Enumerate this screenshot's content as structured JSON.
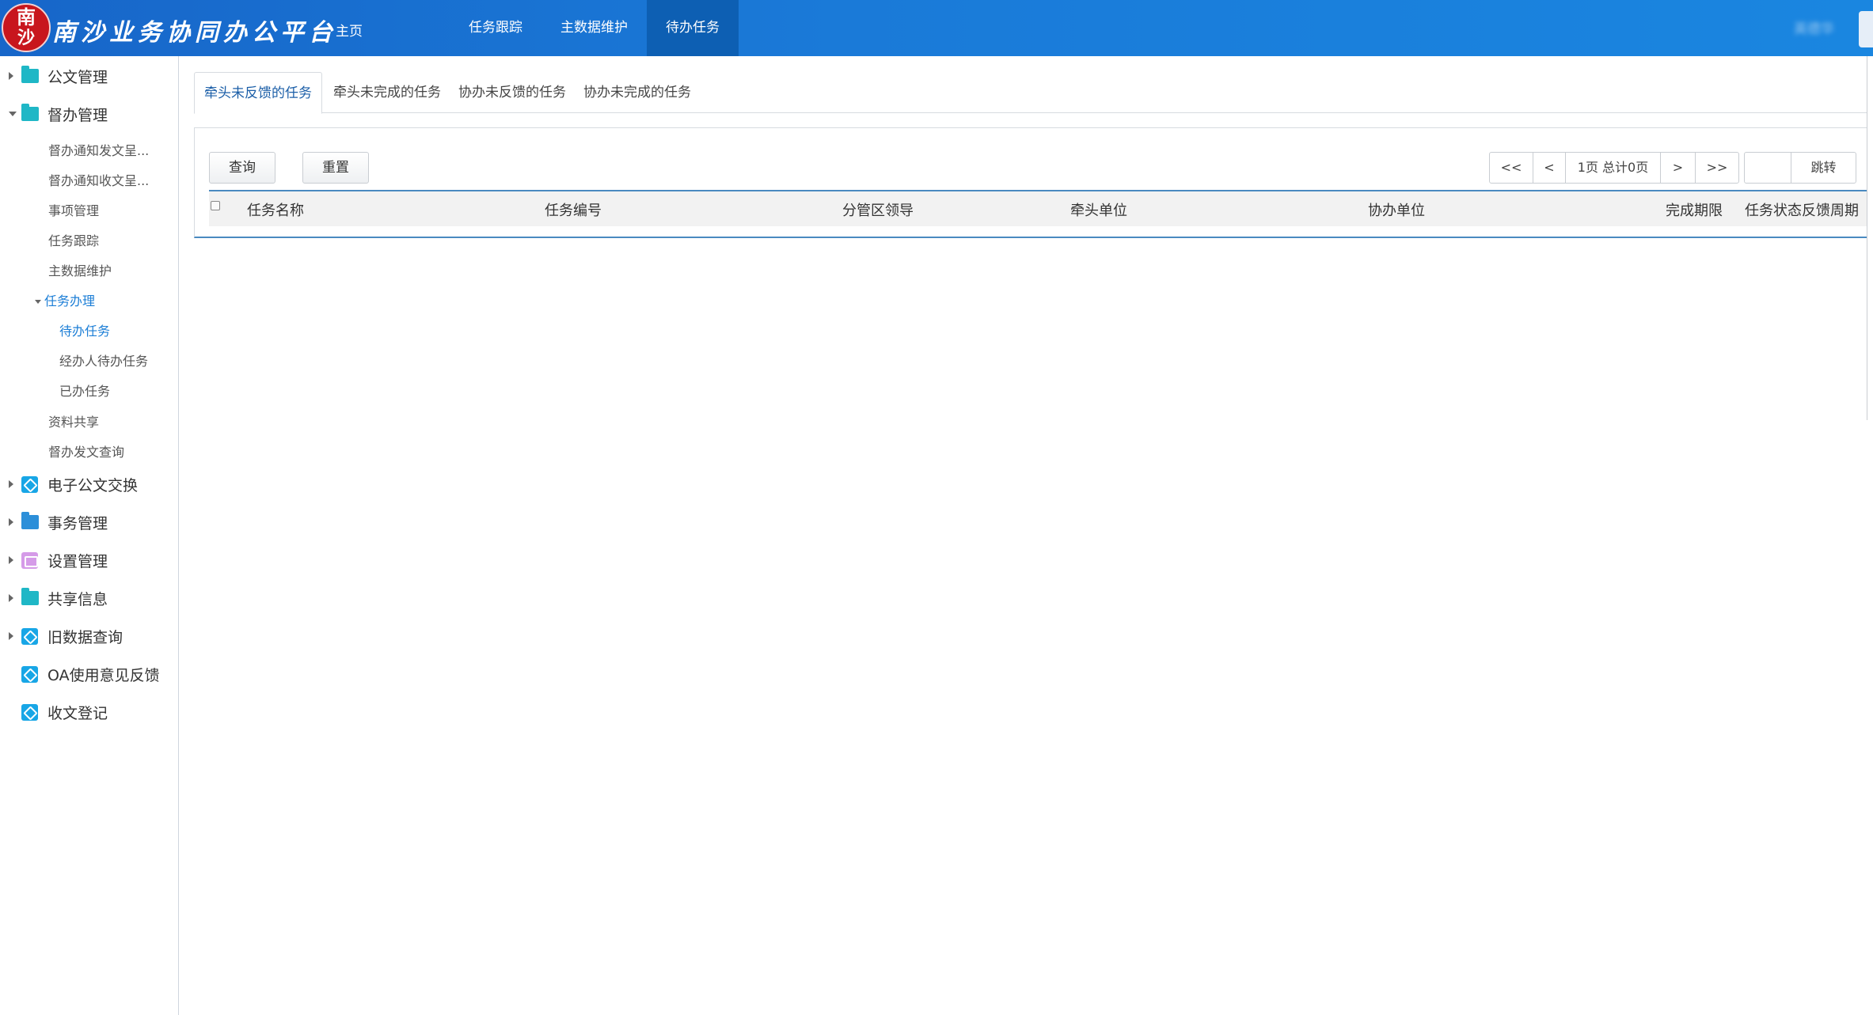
{
  "header": {
    "logo_line1": "南",
    "logo_line2": "沙",
    "app_title": "南沙业务协同办公平台",
    "home_label": "主页",
    "nav": [
      {
        "label": "任务跟踪"
      },
      {
        "label": "主数据维护"
      },
      {
        "label": "待办任务"
      }
    ],
    "user_name": "英德华"
  },
  "sidebar": {
    "groups": [
      {
        "label": "公文管理"
      },
      {
        "label": "督办管理"
      },
      {
        "label": "电子公文交换"
      },
      {
        "label": "事务管理"
      },
      {
        "label": "设置管理"
      },
      {
        "label": "共享信息"
      },
      {
        "label": "旧数据查询"
      },
      {
        "label": "OA使用意见反馈"
      },
      {
        "label": "收文登记"
      }
    ],
    "duban_items": [
      {
        "label": "督办通知发文呈..."
      },
      {
        "label": "督办通知收文呈..."
      },
      {
        "label": "事项管理"
      },
      {
        "label": "任务跟踪"
      },
      {
        "label": "主数据维护"
      },
      {
        "label": "任务办理"
      },
      {
        "label": "待办任务"
      },
      {
        "label": "经办人待办任务"
      },
      {
        "label": "已办任务"
      },
      {
        "label": "资料共享"
      },
      {
        "label": "督办发文查询"
      }
    ]
  },
  "tabs": [
    {
      "label": "牵头未反馈的任务"
    },
    {
      "label": "牵头未完成的任务"
    },
    {
      "label": "协办未反馈的任务"
    },
    {
      "label": "协办未完成的任务"
    }
  ],
  "toolbar": {
    "query_label": "查询",
    "reset_label": "重置",
    "pager_first": "<<",
    "pager_prev": "<",
    "pager_info": "1页 总计0页",
    "pager_next": ">",
    "pager_last": ">>",
    "jump_value": "",
    "jump_label": "跳转"
  },
  "table": {
    "columns": [
      {
        "label": "任务名称"
      },
      {
        "label": "任务编号"
      },
      {
        "label": "分管区领导"
      },
      {
        "label": "牵头单位"
      },
      {
        "label": "协办单位"
      },
      {
        "label": "完成期限"
      },
      {
        "label": "任务状态反馈周期"
      }
    ],
    "rows": []
  },
  "colors": {
    "header_bg": "#1a7ad8",
    "nav_active": "#0d5fb3",
    "logo_red": "#c8161d",
    "active_link": "#1c7ed6"
  }
}
